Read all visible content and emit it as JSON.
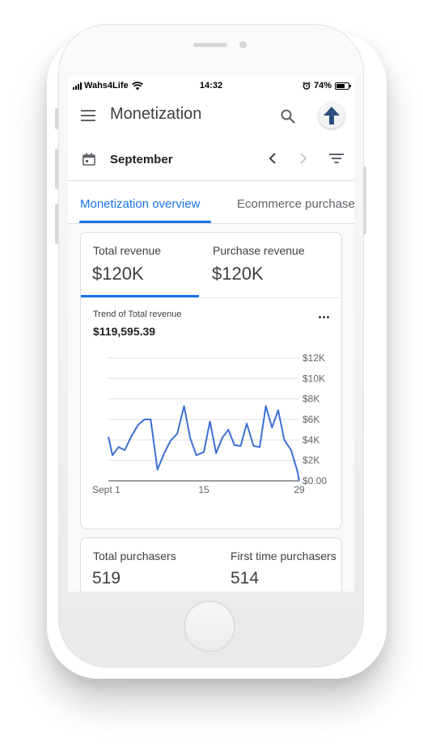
{
  "status_bar": {
    "carrier": "Wahs4Life",
    "time": "14:32",
    "battery_percent": "74%",
    "battery_level": 0.74
  },
  "app_bar": {
    "title": "Monetization",
    "icons": [
      "menu-icon",
      "search-icon",
      "avatar-arrow-icon"
    ]
  },
  "date_selector": {
    "month": "September",
    "icons": [
      "calendar-icon",
      "chevron-left-icon",
      "chevron-right-icon",
      "filter-icon"
    ]
  },
  "tabs": [
    {
      "label": "Monetization overview",
      "active": true
    },
    {
      "label": "Ecommerce purchases",
      "active": false
    }
  ],
  "revenue_card": {
    "metrics": [
      {
        "label": "Total revenue",
        "value": "$120K",
        "selected": true
      },
      {
        "label": "Purchase revenue",
        "value": "$120K",
        "selected": false
      }
    ],
    "trend_label": "Trend of Total revenue",
    "trend_value": "$119,595.39"
  },
  "chart_data": {
    "type": "line",
    "title": "Trend of Total revenue",
    "x_tick_labels": [
      "Sept 1",
      "15",
      "29"
    ],
    "y_tick_labels": [
      "$0.00",
      "$2K",
      "$4K",
      "$6K",
      "$8K",
      "$10K",
      "$12K"
    ],
    "ylim": [
      0,
      12000
    ],
    "xlim": [
      1,
      29
    ],
    "grid": true,
    "y_axis_position": "right",
    "color": "#3b6fd4",
    "series": [
      {
        "x": [
          1,
          1.6,
          2.5,
          3.4,
          4.4,
          5.4,
          6.3,
          7.2,
          8.2,
          9.2,
          10.1,
          11.1,
          12.1,
          13.0,
          13.9,
          15.0,
          15.9,
          16.8,
          17.7,
          18.6,
          19.5,
          20.4,
          21.3,
          22.3,
          23.2,
          24.1,
          25.0,
          25.9,
          26.8,
          27.8,
          28.7,
          29
        ],
        "y": [
          4300,
          2500,
          3300,
          3000,
          4400,
          5500,
          6000,
          6000,
          1100,
          2700,
          3900,
          4600,
          7300,
          4200,
          2500,
          2800,
          5800,
          2700,
          4200,
          5000,
          3500,
          3400,
          5600,
          3400,
          3300,
          7300,
          5200,
          6900,
          4000,
          3000,
          1000,
          0
        ]
      }
    ]
  },
  "purchasers_card": {
    "metrics": [
      {
        "label": "Total purchasers",
        "value": "519"
      },
      {
        "label": "First time purchasers",
        "value": "514"
      }
    ]
  }
}
